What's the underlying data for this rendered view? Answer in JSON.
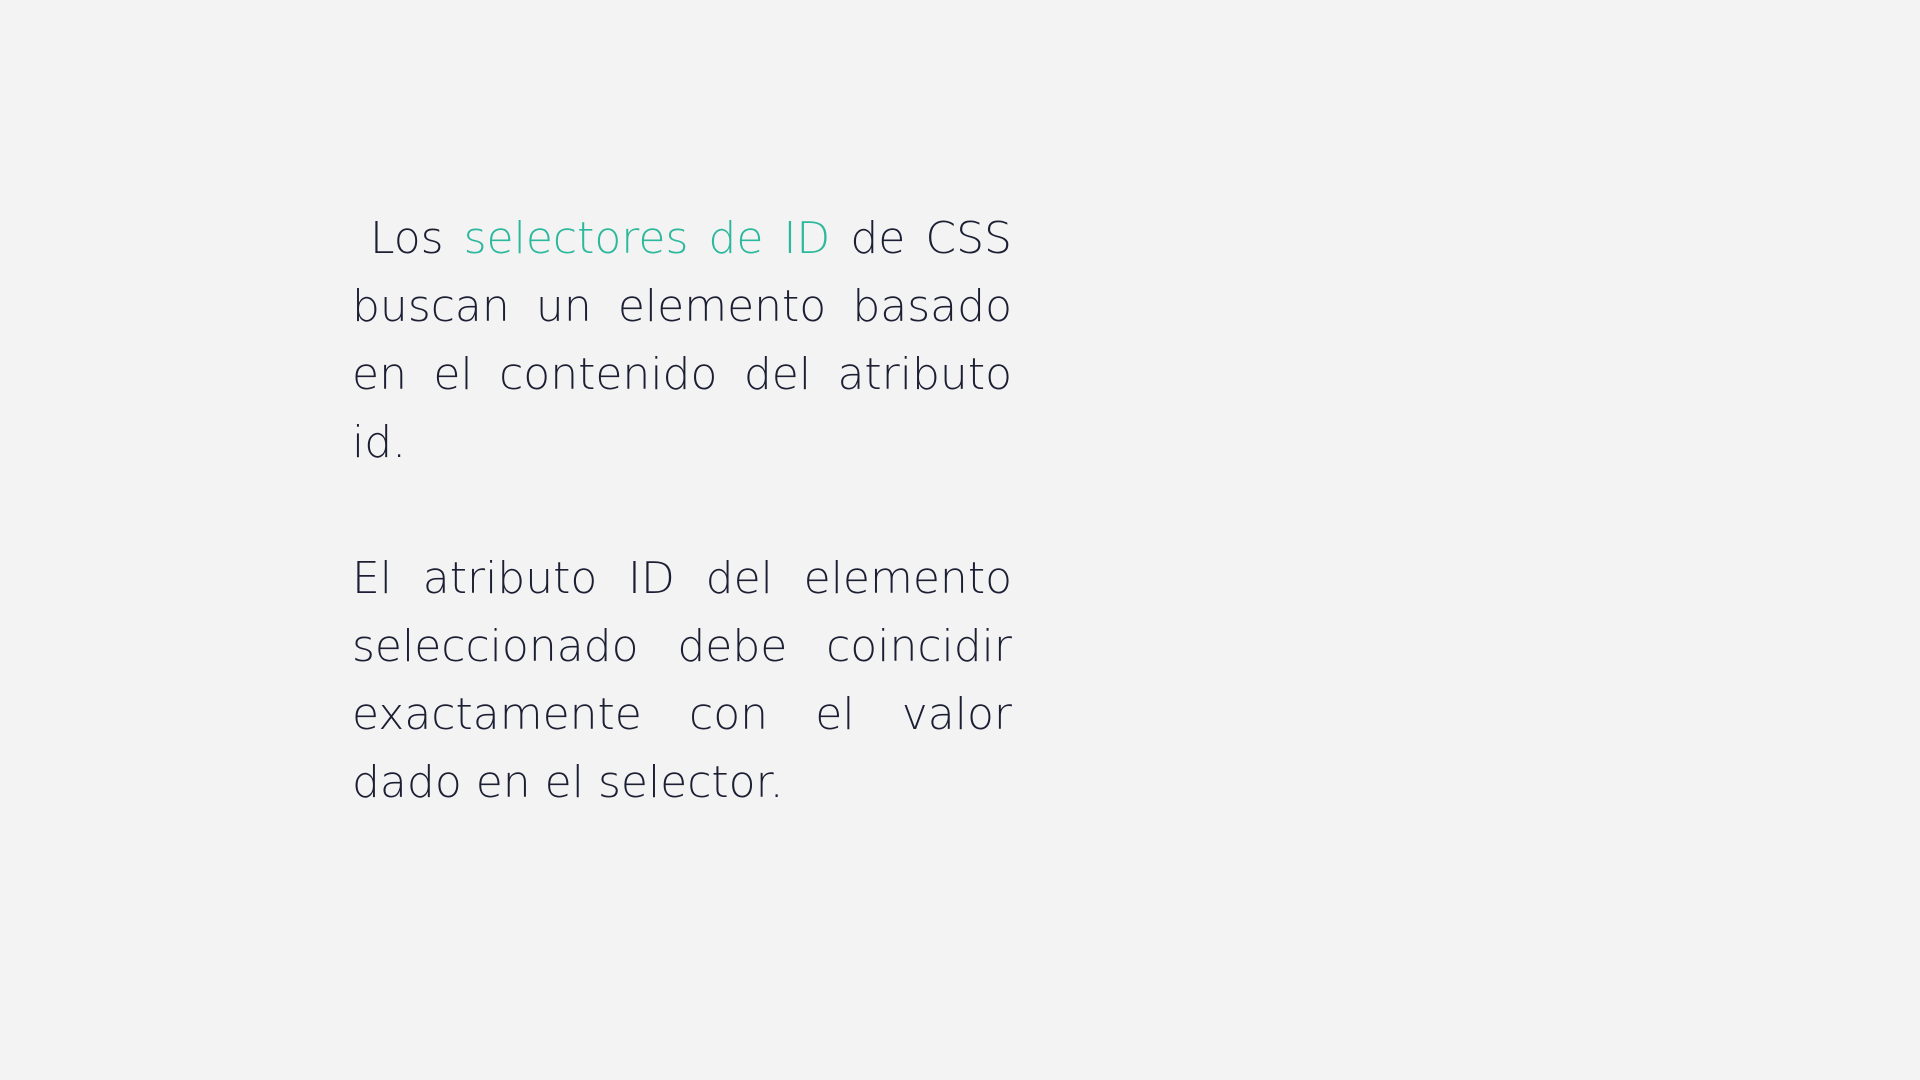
{
  "paragraph_1": {
    "part_before": "Los",
    "highlight": "selectores de ID",
    "part_after": "de CSS buscan un elemento basado en el contenido del atributo id."
  },
  "paragraph_2": {
    "text": "El atributo ID del elemento seleccionado debe coincidir exactamente con el valor dado en el selector."
  },
  "colors": {
    "background": "#f3f3f3",
    "text": "#1c1f33",
    "accent": "#2cb89c"
  }
}
